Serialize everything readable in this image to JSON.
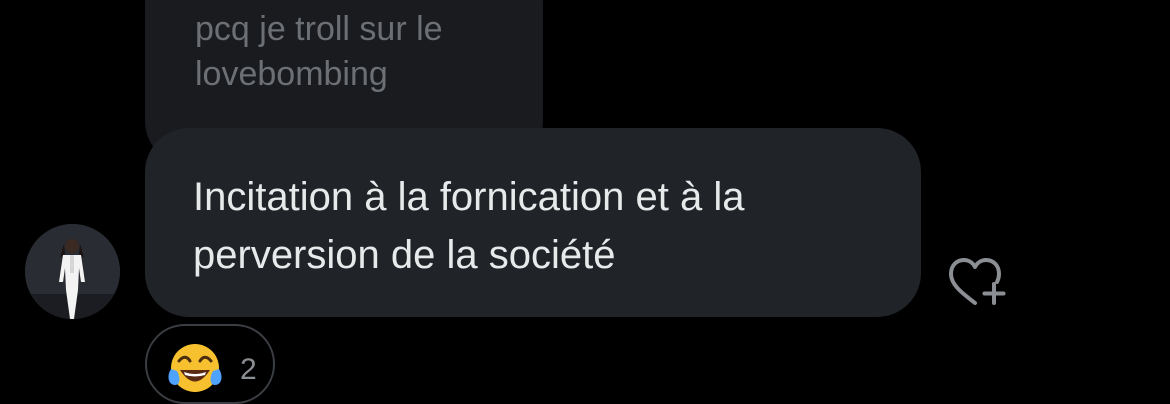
{
  "conversation": {
    "previous_message": {
      "text": "pcq je troll sur le lovebombing"
    },
    "current_message": {
      "text": "Incitation à la fornication et à la perversion de la société",
      "reactions": [
        {
          "emoji_name": "face-with-tears-of-joy-emoji",
          "count": "2"
        }
      ]
    },
    "actions": {
      "like_icon": "heart-plus-icon"
    },
    "sender": {
      "avatar_icon": "avatar-photo"
    }
  },
  "colors": {
    "background": "#000000",
    "bubble": "#202327",
    "text_primary": "#e7e9ea",
    "text_secondary": "#8b8f94",
    "pill_border": "#3a3d42"
  }
}
